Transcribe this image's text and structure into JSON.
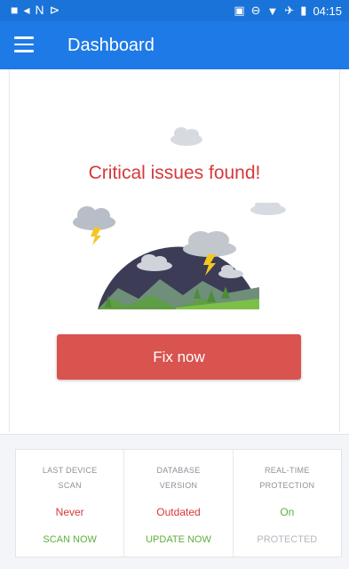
{
  "status_bar": {
    "time": "04:15",
    "left_icons": [
      "video-icon",
      "n-icon",
      "send-icon"
    ],
    "right_icons": [
      "cast-icon",
      "dnd-icon",
      "wifi-icon",
      "airplane-icon",
      "battery-icon"
    ]
  },
  "app_bar": {
    "title": "Dashboard",
    "background": "#1e7ae6"
  },
  "status": {
    "headline": "Critical issues found!",
    "headline_color": "#d6393b"
  },
  "primary_action": {
    "label": "Fix now",
    "color": "#d9534f"
  },
  "cards": [
    {
      "label": "LAST DEVICE SCAN",
      "value": "Never",
      "value_color": "#d6393b",
      "action": "SCAN NOW",
      "action_enabled": true
    },
    {
      "label": "DATABASE VERSION",
      "value": "Outdated",
      "value_color": "#d6393b",
      "action": "UPDATE NOW",
      "action_enabled": true
    },
    {
      "label": "REAL-TIME PROTECTION",
      "value": "On",
      "value_color": "#5fae3c",
      "action": "PROTECTED",
      "action_enabled": false
    }
  ]
}
